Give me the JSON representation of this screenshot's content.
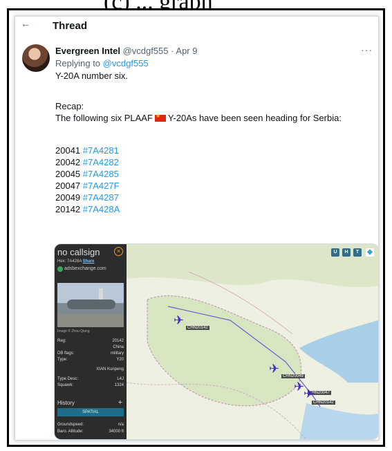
{
  "top_caption": "(c) ... graph",
  "thread": {
    "title": "Thread"
  },
  "tweet": {
    "name": "Evergreen Intel",
    "handle": "@vcdgf555",
    "date": "Apr 9",
    "reply_prefix": "Replying to",
    "reply_to": "@vcdgf555",
    "line1": "Y-20A number six.",
    "recap": "Recap:",
    "following_a": "The following six PLAAF",
    "following_b": "Y-20As have been seen heading for Serbia:",
    "aircraft": [
      {
        "id": "20041",
        "hex": "#7A4281"
      },
      {
        "id": "20042",
        "hex": "#7A4282"
      },
      {
        "id": "20045",
        "hex": "#7A4285"
      },
      {
        "id": "20047",
        "hex": "#7A427F"
      },
      {
        "id": "20049",
        "hex": "#7A4287"
      },
      {
        "id": "20142",
        "hex": "#7A428A"
      }
    ]
  },
  "tracker": {
    "callsign": "no callsign",
    "hex_line": "Hex: 7A428A",
    "share": "Share",
    "source": "adsbexchange.com",
    "photo_caption": "Image © Zhou Qiang",
    "rows": [
      {
        "k": "Reg:",
        "v": "20142"
      },
      {
        "k": "",
        "v": "China"
      },
      {
        "k": "DB flags:",
        "v": "military"
      },
      {
        "k": "Type:",
        "v": "Y20"
      },
      {
        "k": "",
        "v": "XIAN Kunpeng"
      },
      {
        "k": "Type Desc:",
        "v": "L4J"
      },
      {
        "k": "Squawk:",
        "v": "1324"
      }
    ],
    "history": "History",
    "spatial": "SPATIAL",
    "bottom_rows": [
      {
        "k": "Groundspeed:",
        "v": "n/a"
      },
      {
        "k": "Baro. Altitude:",
        "v": "34000 ft"
      }
    ],
    "map_buttons": [
      "U",
      "H",
      "T"
    ],
    "map_labels": [
      "CHN20142",
      "CHN20049",
      "CHN20047",
      "CHN20142"
    ]
  }
}
